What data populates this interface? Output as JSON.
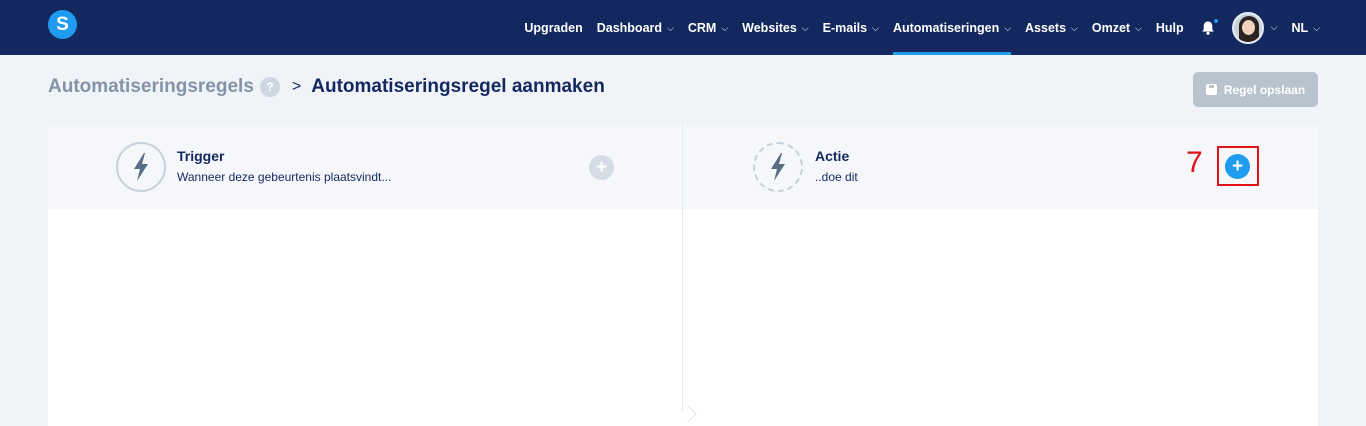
{
  "nav": {
    "logo_letter": "S",
    "items": [
      {
        "label": "Upgraden",
        "chevron": false,
        "active": false
      },
      {
        "label": "Dashboard",
        "chevron": true,
        "active": false
      },
      {
        "label": "CRM",
        "chevron": true,
        "active": false
      },
      {
        "label": "Websites",
        "chevron": true,
        "active": false
      },
      {
        "label": "E-mails",
        "chevron": true,
        "active": false
      },
      {
        "label": "Automatiseringen",
        "chevron": true,
        "active": true
      },
      {
        "label": "Assets",
        "chevron": true,
        "active": false
      },
      {
        "label": "Omzet",
        "chevron": true,
        "active": false
      },
      {
        "label": "Hulp",
        "chevron": false,
        "active": false
      }
    ],
    "language": "NL",
    "chevron_glyph": "⌵",
    "notification_icon": "bell-icon"
  },
  "header": {
    "breadcrumb_parent": "Automatiseringsregels",
    "help_glyph": "?",
    "separator": ">",
    "breadcrumb_current": "Automatiseringsregel aanmaken",
    "save_label": "Regel opslaan"
  },
  "trigger": {
    "title": "Trigger",
    "subtitle": "Wanneer deze gebeurtenis plaatsvindt...",
    "add_glyph": "+"
  },
  "action": {
    "title": "Actie",
    "subtitle": "..doe dit",
    "add_glyph": "+"
  },
  "annotation": {
    "number": "7",
    "color": "#e0131a"
  },
  "colors": {
    "navbar": "#13285e",
    "accent": "#1f9bf0",
    "save_disabled": "#b9c3ce"
  }
}
